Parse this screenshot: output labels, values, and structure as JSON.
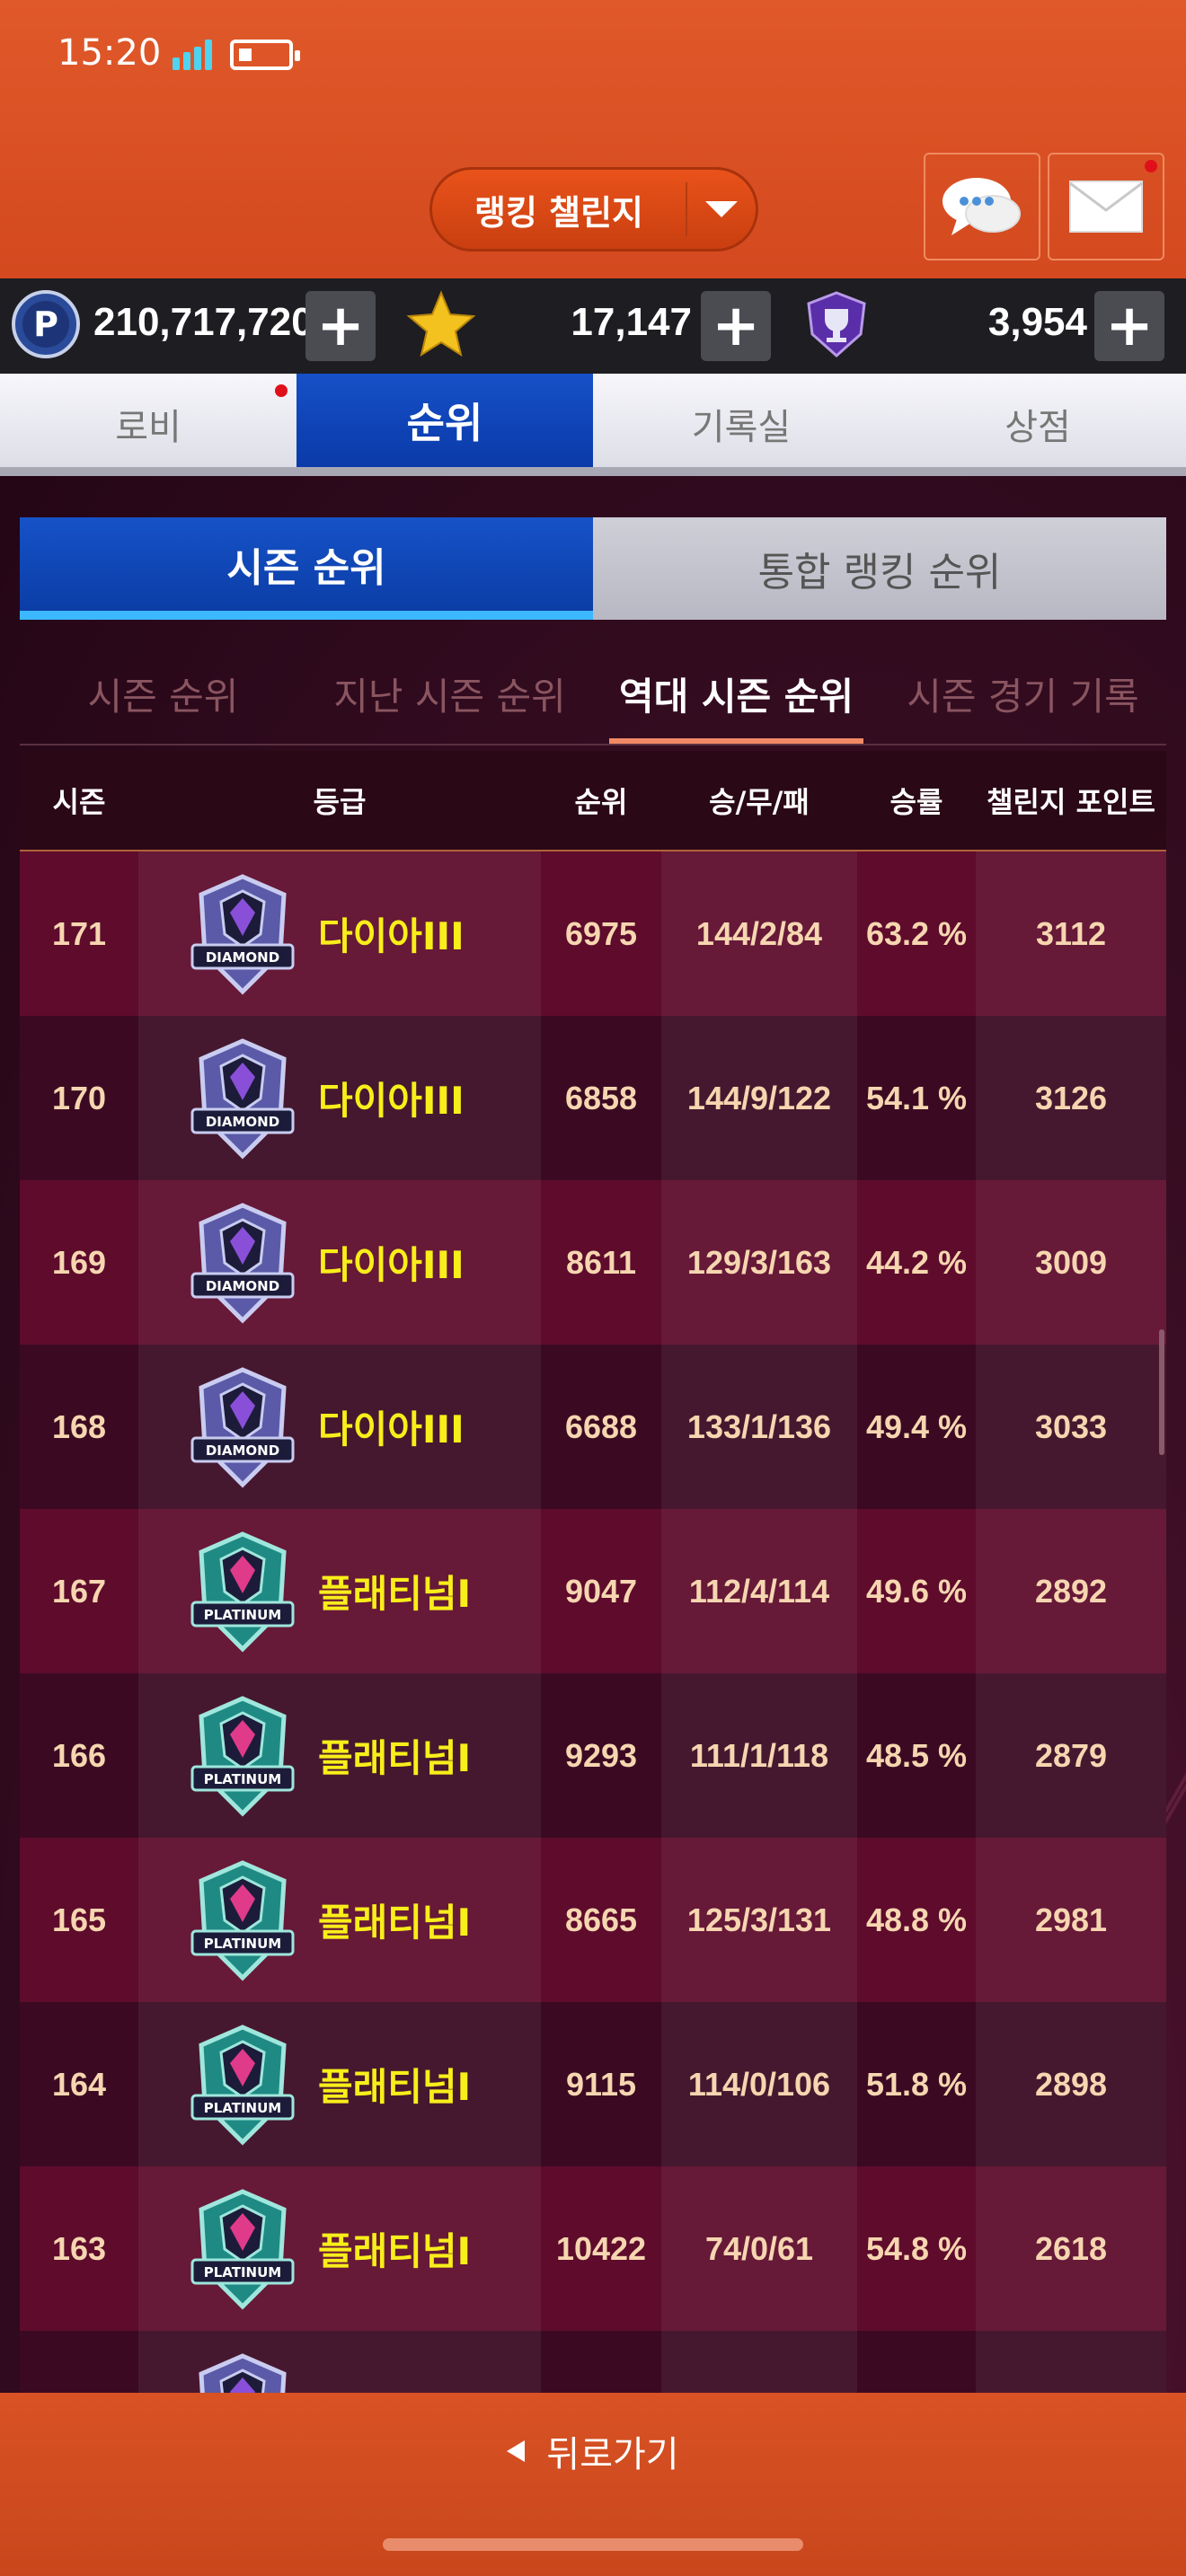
{
  "status_bar": {
    "time": "15:20"
  },
  "header": {
    "mode_label": "랭킹 챌린지",
    "chat_icon": "chat-bubbles-icon",
    "mail_icon": "envelope-icon"
  },
  "currencies": [
    {
      "icon": "p-coin-icon",
      "value": "210,717,720"
    },
    {
      "icon": "star-icon",
      "value": "17,147"
    },
    {
      "icon": "trophy-shield-icon",
      "value": "3,954"
    }
  ],
  "main_tabs": [
    {
      "label": "로비",
      "notify": true
    },
    {
      "label": "순위",
      "active": true
    },
    {
      "label": "기록실"
    },
    {
      "label": "상점"
    }
  ],
  "toggle_tabs": [
    {
      "label": "시즌 순위",
      "active": true
    },
    {
      "label": "통합 랭킹 순위"
    }
  ],
  "filter_tabs": [
    {
      "label": "시즌 순위"
    },
    {
      "label": "지난 시즌 순위"
    },
    {
      "label": "역대 시즌 순위",
      "active": true
    },
    {
      "label": "시즌 경기 기록"
    }
  ],
  "table": {
    "headers": [
      "시즌",
      "등급",
      "순위",
      "승/무/패",
      "승률",
      "챌린지 포인트"
    ],
    "rows": [
      {
        "season": "171",
        "tier": "diamond",
        "grade": "다이아III",
        "rank": "6975",
        "wdl": "144/2/84",
        "rate": "63.2 %",
        "points": "3112"
      },
      {
        "season": "170",
        "tier": "diamond",
        "grade": "다이아III",
        "rank": "6858",
        "wdl": "144/9/122",
        "rate": "54.1 %",
        "points": "3126"
      },
      {
        "season": "169",
        "tier": "diamond",
        "grade": "다이아III",
        "rank": "8611",
        "wdl": "129/3/163",
        "rate": "44.2 %",
        "points": "3009"
      },
      {
        "season": "168",
        "tier": "diamond",
        "grade": "다이아III",
        "rank": "6688",
        "wdl": "133/1/136",
        "rate": "49.4 %",
        "points": "3033"
      },
      {
        "season": "167",
        "tier": "platinum",
        "grade": "플래티넘I",
        "rank": "9047",
        "wdl": "112/4/114",
        "rate": "49.6 %",
        "points": "2892"
      },
      {
        "season": "166",
        "tier": "platinum",
        "grade": "플래티넘I",
        "rank": "9293",
        "wdl": "111/1/118",
        "rate": "48.5 %",
        "points": "2879"
      },
      {
        "season": "165",
        "tier": "platinum",
        "grade": "플래티넘I",
        "rank": "8665",
        "wdl": "125/3/131",
        "rate": "48.8 %",
        "points": "2981"
      },
      {
        "season": "164",
        "tier": "platinum",
        "grade": "플래티넘I",
        "rank": "9115",
        "wdl": "114/0/106",
        "rate": "51.8 %",
        "points": "2898"
      },
      {
        "season": "163",
        "tier": "platinum",
        "grade": "플래티넘I",
        "rank": "10422",
        "wdl": "74/0/61",
        "rate": "54.8 %",
        "points": "2618"
      },
      {
        "season": "",
        "tier": "diamond",
        "grade": "",
        "rank": "",
        "wdl": "",
        "rate": "",
        "points": ""
      }
    ],
    "badge_text": {
      "diamond": "DIAMOND",
      "platinum": "PLATINUM"
    }
  },
  "footer": {
    "back_label": "뒤로가기"
  },
  "colors": {
    "accent": "#d4491f",
    "active_tab": "#0a3aa8",
    "grade_text": "#f8ee1a"
  }
}
